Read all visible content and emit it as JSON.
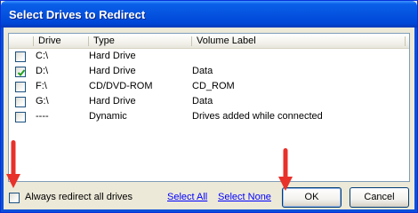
{
  "window": {
    "title": "Select Drives to Redirect"
  },
  "columns": [
    "Drive",
    "Type",
    "Volume Label"
  ],
  "drives": [
    {
      "drive": "C:\\",
      "type": "Hard Drive",
      "label": "",
      "checked": false
    },
    {
      "drive": "D:\\",
      "type": "Hard Drive",
      "label": "Data",
      "checked": true
    },
    {
      "drive": "F:\\",
      "type": "CD/DVD-ROM",
      "label": "CD_ROM",
      "checked": false
    },
    {
      "drive": "G:\\",
      "type": "Hard Drive",
      "label": "Data",
      "checked": false
    },
    {
      "drive": "----",
      "type": "Dynamic",
      "label": "Drives added while connected",
      "checked": false
    }
  ],
  "footer": {
    "always_label": "Always redirect all drives",
    "always_checked": false,
    "select_all": "Select All",
    "select_none": "Select None",
    "ok": "OK",
    "cancel": "Cancel"
  },
  "colors": {
    "titlebar": "#0553e0",
    "link": "#0000ff",
    "arrow": "#e8312a",
    "check": "#21a121"
  }
}
